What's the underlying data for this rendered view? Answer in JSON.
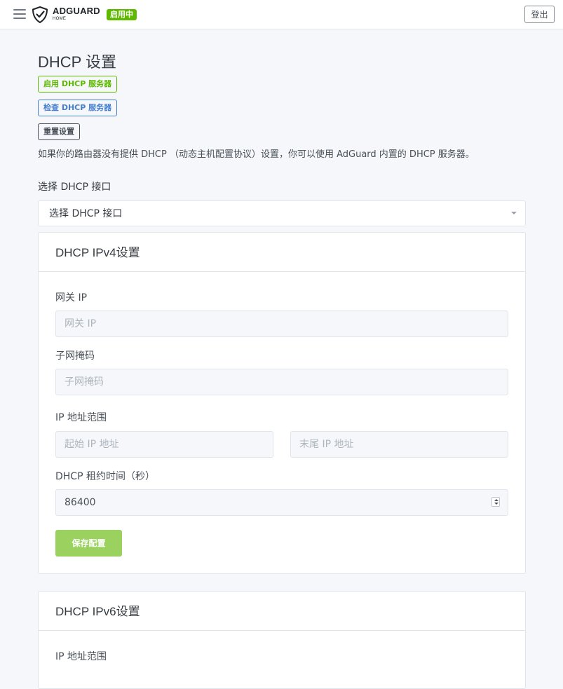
{
  "header": {
    "logo_main": "ADGUARD",
    "logo_sub": "HOME",
    "status_badge": "启用中",
    "logout_label": "登出"
  },
  "page": {
    "title": "DHCP 设置",
    "enable_button": "启用 DHCP 服务器",
    "check_button": "检查 DHCP 服务器",
    "reset_button": "重置设置",
    "description": "如果你的路由器没有提供 DHCP （动态主机配置协议）设置，你可以使用 AdGuard 内置的 DHCP 服务器。",
    "select_label": "选择 DHCP 接口",
    "select_value": "选择 DHCP 接口"
  },
  "ipv4": {
    "title": "DHCP IPv4设置",
    "gateway_label": "网关 IP",
    "gateway_placeholder": "网关 IP",
    "subnet_label": "子网掩码",
    "subnet_placeholder": "子网掩码",
    "range_label": "IP 地址范围",
    "range_start_placeholder": "起始 IP 地址",
    "range_end_placeholder": "末尾 IP 地址",
    "lease_label": "DHCP 租约时间（秒）",
    "lease_value": "86400",
    "save_label": "保存配置"
  },
  "ipv6": {
    "title": "DHCP IPv6设置",
    "range_label": "IP 地址范围"
  },
  "colors": {
    "accent_green": "#5eba00",
    "primary_blue": "#467fcf",
    "save_button_disabled": "#9bd15f",
    "background": "#f5f7fb"
  }
}
